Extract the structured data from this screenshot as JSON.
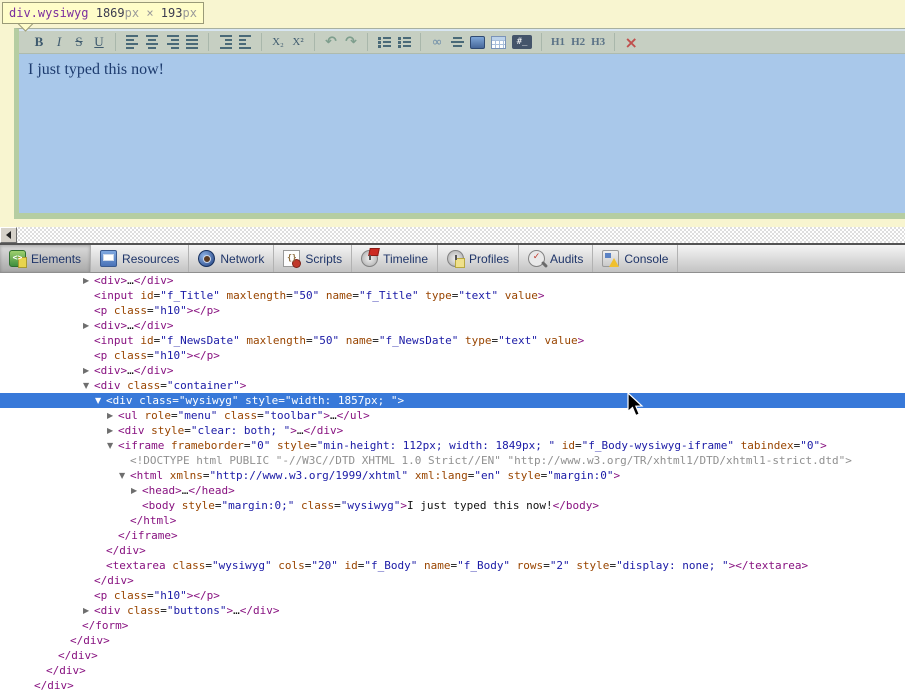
{
  "inspect_tooltip": {
    "selector": "div.wysiwyg",
    "width_value": "1869",
    "width_unit": "px",
    "times": "×",
    "height_value": "193",
    "height_unit": "px"
  },
  "editor": {
    "content_text": "I just typed this now!",
    "toolbar_groups": [
      {
        "buttons": [
          {
            "name": "bold",
            "glyph": "B"
          },
          {
            "name": "italic",
            "glyph": "I"
          },
          {
            "name": "strikethrough",
            "glyph": "S"
          },
          {
            "name": "underline",
            "glyph": "U"
          }
        ]
      },
      {
        "buttons": [
          {
            "name": "align-left",
            "icon": "align-left"
          },
          {
            "name": "align-center",
            "icon": "align-center"
          },
          {
            "name": "align-right",
            "icon": "align-right"
          },
          {
            "name": "align-justify",
            "icon": "align-justify"
          }
        ]
      },
      {
        "buttons": [
          {
            "name": "outdent",
            "icon": "outdent"
          },
          {
            "name": "indent",
            "icon": "indent"
          }
        ]
      },
      {
        "buttons": [
          {
            "name": "subscript",
            "glyph": "X₂"
          },
          {
            "name": "superscript",
            "glyph": "X²"
          }
        ]
      },
      {
        "buttons": [
          {
            "name": "undo",
            "glyph": "↶"
          },
          {
            "name": "redo",
            "glyph": "↷"
          }
        ]
      },
      {
        "buttons": [
          {
            "name": "ordered-list",
            "icon": "list-num"
          },
          {
            "name": "unordered-list",
            "icon": "list-bullet"
          }
        ]
      },
      {
        "buttons": [
          {
            "name": "link",
            "glyph": "∞"
          },
          {
            "name": "horizontal-rule",
            "icon": "hr"
          },
          {
            "name": "image",
            "icon": "image"
          },
          {
            "name": "table",
            "icon": "table"
          },
          {
            "name": "special-char",
            "glyph": "#_"
          }
        ]
      },
      {
        "buttons": [
          {
            "name": "heading-1",
            "glyph": "H1"
          },
          {
            "name": "heading-2",
            "glyph": "H2"
          },
          {
            "name": "heading-3",
            "glyph": "H3"
          }
        ]
      },
      {
        "buttons": [
          {
            "name": "remove",
            "glyph": "×"
          }
        ]
      }
    ]
  },
  "devtools": {
    "tabs": [
      {
        "label": "Elements",
        "icon": "elements",
        "selected": true
      },
      {
        "label": "Resources",
        "icon": "resources",
        "selected": false
      },
      {
        "label": "Network",
        "icon": "network",
        "selected": false
      },
      {
        "label": "Scripts",
        "icon": "scripts",
        "selected": false
      },
      {
        "label": "Timeline",
        "icon": "timeline",
        "selected": false
      },
      {
        "label": "Profiles",
        "icon": "profiles",
        "selected": false
      },
      {
        "label": "Audits",
        "icon": "audits",
        "selected": false
      },
      {
        "label": "Console",
        "icon": "console",
        "selected": false
      }
    ],
    "tree_rows": [
      {
        "text": "<div>…</div>",
        "level": 5,
        "expand": "c"
      },
      {
        "text": "<input id=\"f_Title\" maxlength=\"50\" name=\"f_Title\" type=\"text\" value>",
        "level": 5
      },
      {
        "text": "<p class=\"h10\"></p>",
        "level": 5
      },
      {
        "text": "<div>…</div>",
        "level": 5,
        "expand": "c"
      },
      {
        "text": "<input id=\"f_NewsDate\" maxlength=\"50\" name=\"f_NewsDate\" type=\"text\" value>",
        "level": 5
      },
      {
        "text": "<p class=\"h10\"></p>",
        "level": 5
      },
      {
        "text": "<div>…</div>",
        "level": 5,
        "expand": "c"
      },
      {
        "text": "<div class=\"container\">",
        "level": 5,
        "expand": "o"
      },
      {
        "text": "<div class=\"wysiwyg\" style=\"width: 1857px; \">",
        "level": 6,
        "expand": "o",
        "selected": true
      },
      {
        "text": "<ul role=\"menu\" class=\"toolbar\">…</ul>",
        "level": 7,
        "expand": "c"
      },
      {
        "text": "<div style=\"clear: both; \">…</div>",
        "level": 7,
        "expand": "c"
      },
      {
        "text": "<iframe frameborder=\"0\" style=\"min-height: 112px; width: 1849px; \" id=\"f_Body-wysiwyg-iframe\" tabindex=\"0\">",
        "level": 7,
        "expand": "o"
      },
      {
        "text": "<!DOCTYPE html PUBLIC \"-//W3C//DTD XHTML 1.0 Strict//EN\" \"http://www.w3.org/TR/xhtml1/DTD/xhtml1-strict.dtd\">",
        "level": 8,
        "muted": true
      },
      {
        "text": "<html xmlns=\"http://www.w3.org/1999/xhtml\" xml:lang=\"en\" style=\"margin:0\">",
        "level": 8,
        "expand": "o"
      },
      {
        "text": "<head>…</head>",
        "level": 9,
        "expand": "c"
      },
      {
        "text": "<body style=\"margin:0;\" class=\"wysiwyg\">I just typed this now!</body>",
        "level": 9
      },
      {
        "text": "</html>",
        "level": 8
      },
      {
        "text": "</iframe>",
        "level": 7
      },
      {
        "text": "</div>",
        "level": 6
      },
      {
        "text": "<textarea class=\"wysiwyg\" cols=\"20\" id=\"f_Body\" name=\"f_Body\" rows=\"2\" style=\"display: none; \"></textarea>",
        "level": 6
      },
      {
        "text": "</div>",
        "level": 5
      },
      {
        "text": "<p class=\"h10\"></p>",
        "level": 5
      },
      {
        "text": "<div class=\"buttons\">…</div>",
        "level": 5,
        "expand": "c"
      },
      {
        "text": "</form>",
        "level": 4
      },
      {
        "text": "</div>",
        "level": 3
      },
      {
        "text": "</div>",
        "level": 2
      },
      {
        "text": "</div>",
        "level": 1
      },
      {
        "text": "</div>",
        "level": 0
      }
    ]
  },
  "colors": {
    "selection_blue": "#3879d9",
    "tag": "#881280",
    "attribute": "#994500",
    "value": "#1a1aa6",
    "muted": "#909090",
    "highlight_content": "#a9c8ea",
    "highlight_padding": "#b5cda2",
    "page_background": "#f8f5d0",
    "tooltip_background": "#fffdc9",
    "remove_button_red": "#c0504d"
  }
}
